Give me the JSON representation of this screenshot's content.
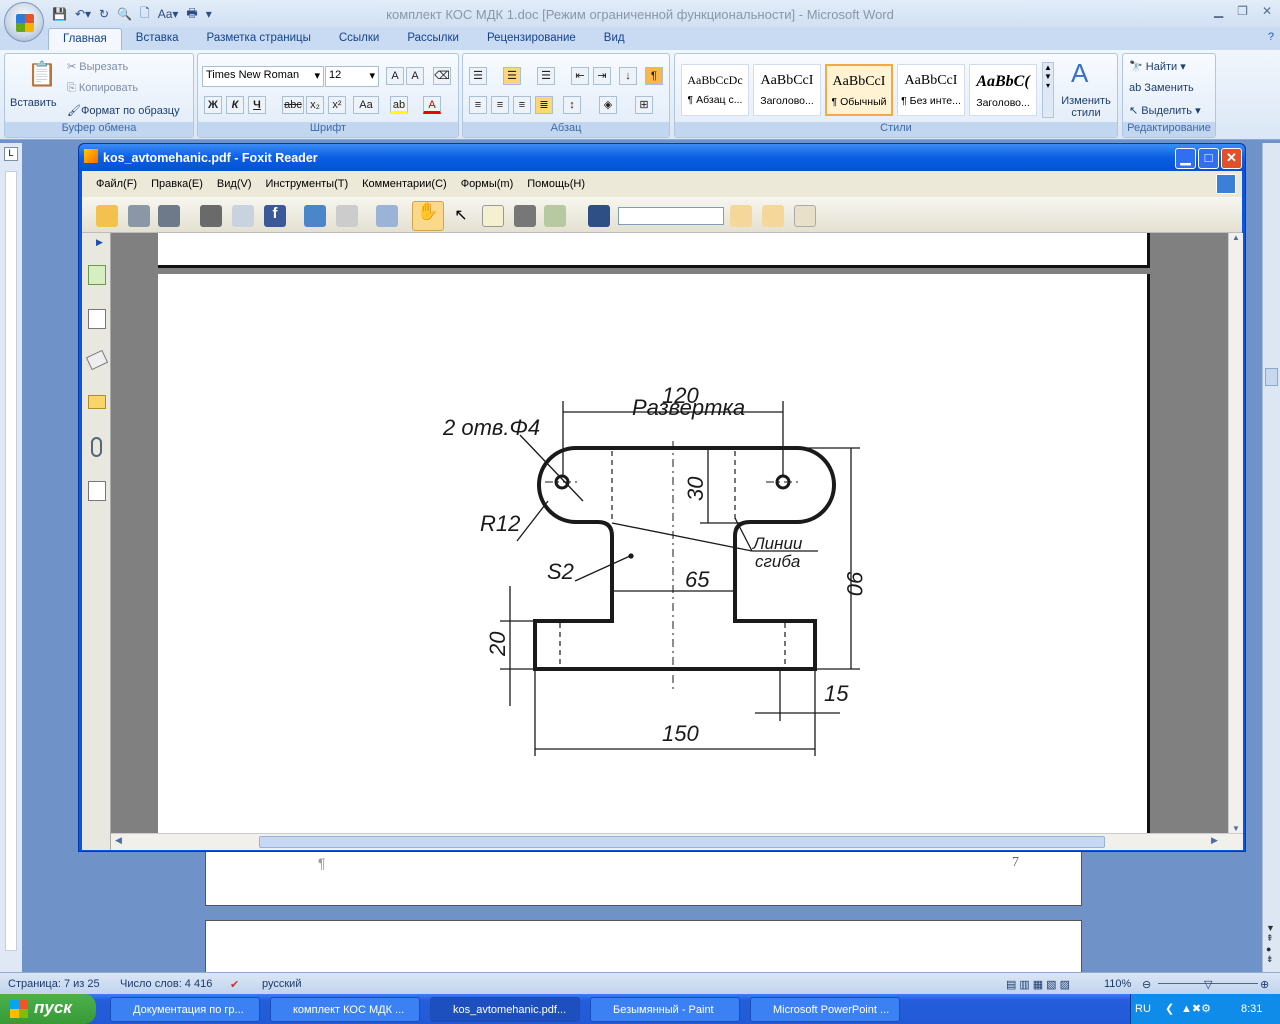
{
  "word": {
    "title": "комплект КОС МДК 1.doc [Режим ограниченной функциональности] - Microsoft Word",
    "tabs": [
      "Главная",
      "Вставка",
      "Разметка страницы",
      "Ссылки",
      "Рассылки",
      "Рецензирование",
      "Вид"
    ],
    "clipboard": {
      "paste": "Вставить",
      "cut": "Вырезать",
      "copy": "Копировать",
      "format_painter": "Формат по образцу",
      "label": "Буфер обмена"
    },
    "font": {
      "name": "Times New Roman",
      "size": "12",
      "label": "Шрифт",
      "bold": "Ж",
      "italic": "К",
      "underline": "Ч",
      "strike": "abc",
      "sub": "x₂",
      "sup": "x²",
      "case": "Aa"
    },
    "paragraph": {
      "label": "Абзац"
    },
    "styles": {
      "label": "Стили",
      "items": [
        {
          "preview": "AaBbCcDc",
          "name": "¶ Абзац с..."
        },
        {
          "preview": "AaBbCcI",
          "name": "Заголово..."
        },
        {
          "preview": "AaBbCcI",
          "name": "¶ Обычный"
        },
        {
          "preview": "AaBbCcI",
          "name": "¶ Без инте..."
        },
        {
          "preview": "AaBbC(",
          "name": "Заголово..."
        }
      ],
      "change": "Изменить стили"
    },
    "editing": {
      "label": "Редактирование",
      "find": "Найти",
      "replace": "Заменить",
      "select": "Выделить"
    },
    "page_number": "7",
    "pilcrow": "¶",
    "status": {
      "page": "Страница: 7 из 25",
      "words": "Число слов: 4 416",
      "lang": "русский",
      "zoom": "110%"
    }
  },
  "foxit": {
    "title": "kos_avtomehanic.pdf - Foxit Reader",
    "menu": [
      "Файл(F)",
      "Правка(E)",
      "Вид(V)",
      "Инструменты(T)",
      "Комментарии(C)",
      "Формы(m)",
      "Помощь(H)"
    ],
    "search_value": "",
    "drawing": {
      "holes": "2 отв.Φ4",
      "unfold": "Развертка",
      "d120": "120",
      "d30": "30",
      "d90": "90",
      "r12": "R12",
      "s2": "S2",
      "d65": "65",
      "bend1": "Линии",
      "bend2": "сгиба",
      "d20": "20",
      "d15": "15",
      "d150": "150"
    }
  },
  "taskbar": {
    "start": "пуск",
    "tasks": [
      "Документация по гр...",
      "комплект КОС МДК ...",
      "kos_avtomehanic.pdf...",
      "Безымянный - Paint",
      "Microsoft PowerPoint ..."
    ],
    "lang": "RU",
    "time": "8:31"
  }
}
